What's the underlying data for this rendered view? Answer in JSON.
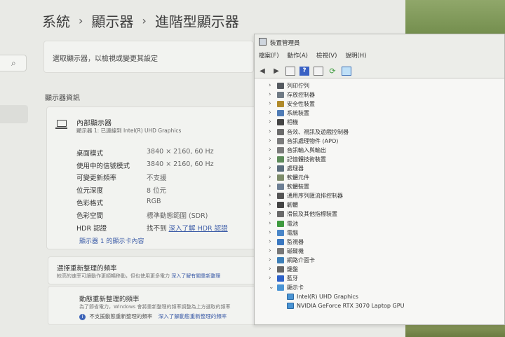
{
  "settings": {
    "breadcrumb": [
      "系統",
      "顯示器",
      "進階型顯示器"
    ],
    "select_label": "選取顯示器，以檢視或變更其設定",
    "section_title": "顯示器資訊",
    "display": {
      "name": "內部顯示器",
      "subtitle": "顯示器 1: 已連線到 Intel(R) UHD Graphics"
    },
    "info_rows": [
      {
        "label": "桌面模式",
        "value": "3840 × 2160, 60 Hz"
      },
      {
        "label": "使用中的信號模式",
        "value": "3840 × 2160, 60 Hz"
      },
      {
        "label": "可變更新頻率",
        "value": "不支援"
      },
      {
        "label": "位元深度",
        "value": "8 位元"
      },
      {
        "label": "色彩格式",
        "value": "RGB"
      },
      {
        "label": "色彩空間",
        "value": "標準動態範圍 (SDR)"
      },
      {
        "label": "HDR 認證",
        "value": "找不到",
        "link": "深入了解 HDR 認證"
      }
    ],
    "adapter_link": "顯示器 1 的顯示卡內容",
    "refresh": {
      "title": "選擇重新整理的頻率",
      "subtitle": "較高的速率可讓動作更順暢移動，但也使用更多電力",
      "link": "深入了解有關重新整理"
    },
    "dynamic_refresh": {
      "title": "動態重新整理的頻率",
      "subtitle": "為了節省電力，Windows 會將重新整理的頻率調整為上方選取的頻率",
      "info": "不支援動態重新整理的頻率",
      "link": "深入了解動態重新整理的頻率"
    }
  },
  "device_manager": {
    "title": "裝置管理員",
    "menu": [
      "檔案(F)",
      "動作(A)",
      "檢視(V)",
      "說明(H)"
    ],
    "tree": [
      {
        "label": "列印佇列",
        "icon_color": "#555a60"
      },
      {
        "label": "存放控制器",
        "icon_color": "#6f7a84"
      },
      {
        "label": "安全性裝置",
        "icon_color": "#b08a2a"
      },
      {
        "label": "系統裝置",
        "icon_color": "#4f7bb5"
      },
      {
        "label": "相機",
        "icon_color": "#444444"
      },
      {
        "label": "音效、視訊及遊戲控制器",
        "icon_color": "#6b6b6b"
      },
      {
        "label": "音訊處理物件 (APO)",
        "icon_color": "#7b7b7b"
      },
      {
        "label": "音訊輸入與輸出",
        "icon_color": "#7b7b7b"
      },
      {
        "label": "記憶體技術裝置",
        "icon_color": "#5d8b5a"
      },
      {
        "label": "處理器",
        "icon_color": "#5b6e7e"
      },
      {
        "label": "軟體元件",
        "icon_color": "#7d8c6a"
      },
      {
        "label": "軟體裝置",
        "icon_color": "#6d7f94"
      },
      {
        "label": "通用序列匯流排控制器",
        "icon_color": "#555555"
      },
      {
        "label": "韌體",
        "icon_color": "#444444"
      },
      {
        "label": "滑鼠及其他指標裝置",
        "icon_color": "#6a6a6a"
      },
      {
        "label": "電池",
        "icon_color": "#3f9a3f"
      },
      {
        "label": "電腦",
        "icon_color": "#4a86c8"
      },
      {
        "label": "監視器",
        "icon_color": "#3b78c0"
      },
      {
        "label": "磁碟機",
        "icon_color": "#777777"
      },
      {
        "label": "網路介面卡",
        "icon_color": "#3d7fb8"
      },
      {
        "label": "鍵盤",
        "icon_color": "#666666"
      },
      {
        "label": "藍牙",
        "icon_color": "#2e62c9"
      },
      {
        "label": "顯示卡",
        "icon_color": "#4a94d4",
        "expanded": true
      }
    ],
    "display_adapters": [
      "Intel(R) UHD Graphics",
      "NVIDIA GeForce RTX 3070 Laptop GPU"
    ]
  }
}
